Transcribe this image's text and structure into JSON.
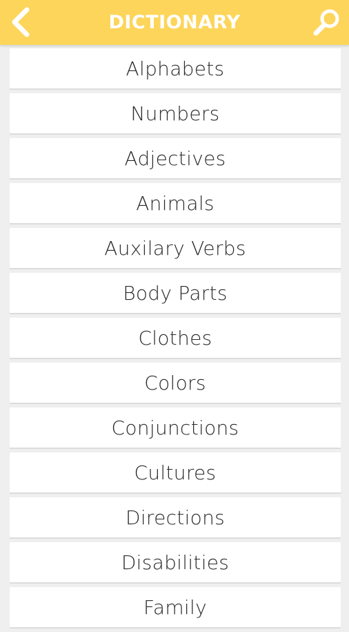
{
  "header": {
    "title": "DICTIONARY",
    "back_icon": "chevron-left-icon",
    "search_icon": "search-icon",
    "bar_color": "#fdd55a"
  },
  "categories": [
    {
      "label": "Alphabets"
    },
    {
      "label": "Numbers"
    },
    {
      "label": "Adjectives"
    },
    {
      "label": "Animals"
    },
    {
      "label": "Auxilary Verbs"
    },
    {
      "label": "Body Parts"
    },
    {
      "label": "Clothes"
    },
    {
      "label": "Colors"
    },
    {
      "label": "Conjunctions"
    },
    {
      "label": "Cultures"
    },
    {
      "label": "Directions"
    },
    {
      "label": "Disabilities"
    },
    {
      "label": "Family"
    }
  ]
}
